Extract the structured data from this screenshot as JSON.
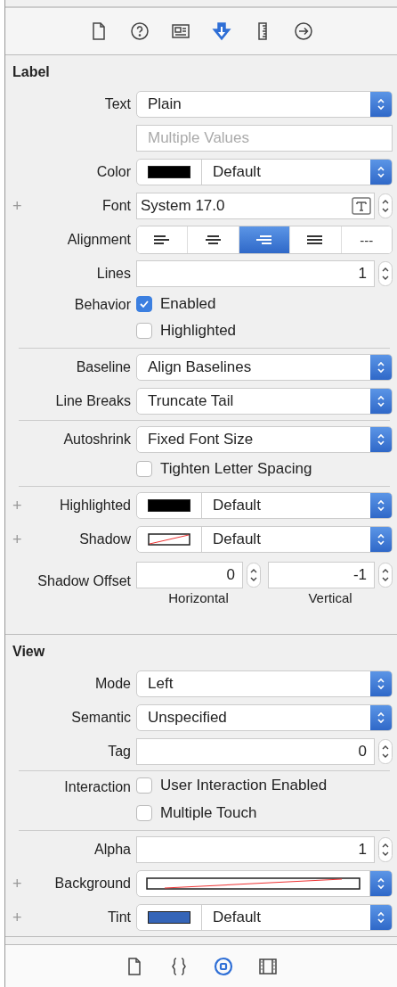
{
  "inspector_tabs": [
    {
      "kind": "file",
      "selected": false
    },
    {
      "kind": "help",
      "selected": false
    },
    {
      "kind": "identity",
      "selected": false
    },
    {
      "kind": "attributes",
      "selected": true
    },
    {
      "kind": "size",
      "selected": false
    },
    {
      "kind": "connections",
      "selected": false
    }
  ],
  "sections": [
    {
      "title": "Label",
      "groups": [
        [
          {
            "kind": "popup",
            "label": "Text",
            "value": "Plain"
          },
          {
            "kind": "field",
            "placeholder": "Multiple Values"
          },
          {
            "kind": "color",
            "label": "Color",
            "color": "#000000",
            "value": "Default"
          },
          {
            "kind": "font",
            "add": "+",
            "label": "Font",
            "value": "System 17.0"
          },
          {
            "kind": "segmented",
            "label": "Alignment",
            "segments": [
              {
                "kind": "left",
                "selected": false
              },
              {
                "kind": "center",
                "selected": false
              },
              {
                "kind": "right",
                "selected": true
              },
              {
                "kind": "justified",
                "selected": false
              },
              {
                "kind": "natural",
                "text": "---",
                "selected": false
              }
            ]
          },
          {
            "kind": "number",
            "label": "Lines",
            "value": "1"
          },
          {
            "kind": "checkbox",
            "label": "Behavior",
            "text": "Enabled",
            "checked": true
          },
          {
            "kind": "checkbox",
            "text": "Highlighted",
            "checked": false
          }
        ],
        [
          {
            "kind": "popup",
            "label": "Baseline",
            "value": "Align Baselines"
          },
          {
            "kind": "popup",
            "label": "Line Breaks",
            "value": "Truncate Tail"
          }
        ],
        [
          {
            "kind": "popup",
            "label": "Autoshrink",
            "value": "Fixed Font Size"
          },
          {
            "kind": "checkbox",
            "text": "Tighten Letter Spacing",
            "checked": false
          }
        ],
        [
          {
            "kind": "color",
            "add": "+",
            "label": "Highlighted",
            "color": "#000000",
            "value": "Default"
          },
          {
            "kind": "color",
            "add": "+",
            "label": "Shadow",
            "value": "Default"
          },
          {
            "kind": "pair",
            "label": "Shadow Offset",
            "fields": [
              {
                "value": "0",
                "caption": "Horizontal"
              },
              {
                "value": "-1",
                "caption": "Vertical"
              }
            ]
          }
        ]
      ]
    },
    {
      "title": "View",
      "groups": [
        [
          {
            "kind": "popup",
            "label": "Mode",
            "value": "Left"
          },
          {
            "kind": "popup",
            "label": "Semantic",
            "value": "Unspecified"
          },
          {
            "kind": "number",
            "label": "Tag",
            "value": "0"
          }
        ],
        [
          {
            "kind": "checkbox",
            "label": "Interaction",
            "text": "User Interaction Enabled",
            "checked": false
          },
          {
            "kind": "checkbox",
            "text": "Multiple Touch",
            "checked": false
          }
        ],
        [
          {
            "kind": "number",
            "label": "Alpha",
            "value": "1"
          },
          {
            "kind": "wide_color",
            "add": "+",
            "label": "Background"
          },
          {
            "kind": "color",
            "add": "+",
            "label": "Tint",
            "color": "#3565b8",
            "value": "Default"
          }
        ]
      ]
    }
  ],
  "library_tabs": [
    {
      "kind": "file",
      "selected": false
    },
    {
      "kind": "code",
      "selected": false
    },
    {
      "kind": "object",
      "selected": true
    },
    {
      "kind": "media",
      "selected": false
    }
  ]
}
